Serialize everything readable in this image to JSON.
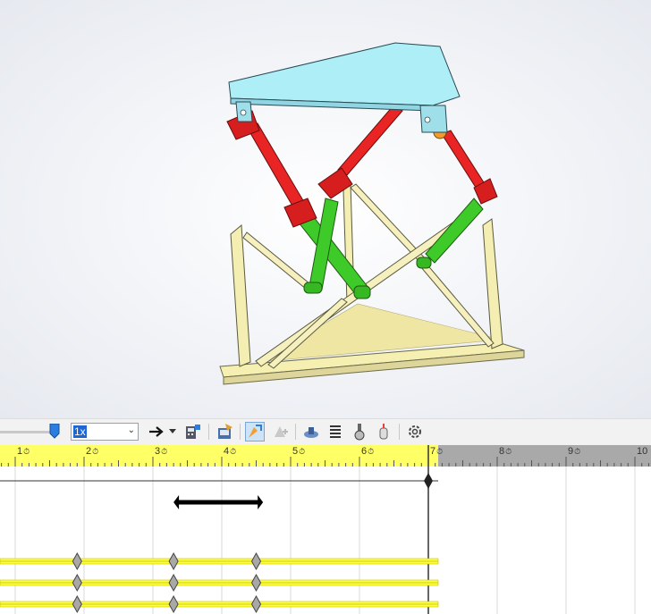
{
  "toolbar": {
    "speed": {
      "value": "1x",
      "options": [
        "1x"
      ]
    },
    "icons": [
      "play-forward-icon",
      "dropdown-arrow-icon",
      "calculate-animation-icon",
      "save-animation-icon",
      "autokey-icon",
      "add-key-icon",
      "motor-icon",
      "spring-icon",
      "contact-icon",
      "gravity-icon",
      "settings-icon"
    ]
  },
  "timeline": {
    "time_labels": [
      "1 sec",
      "2 sec",
      "3 sec",
      "4 sec",
      "5 sec",
      "6 sec",
      "7 sec",
      "8 sec",
      "9 sec",
      "10"
    ],
    "tick_texts": [
      "1",
      "2",
      "3",
      "4",
      "5",
      "6",
      "7",
      "8",
      "9",
      "10"
    ],
    "current_time_sec": 7,
    "key_row_times": [
      0.9,
      2.3,
      3.5
    ],
    "key_bar_range": [
      3.3,
      4.6
    ],
    "colors": {
      "ruler": "#ffff66",
      "ruler_inactive": "#a9a9a9",
      "track": "#ffff33",
      "key": "#a8a8a8"
    }
  }
}
